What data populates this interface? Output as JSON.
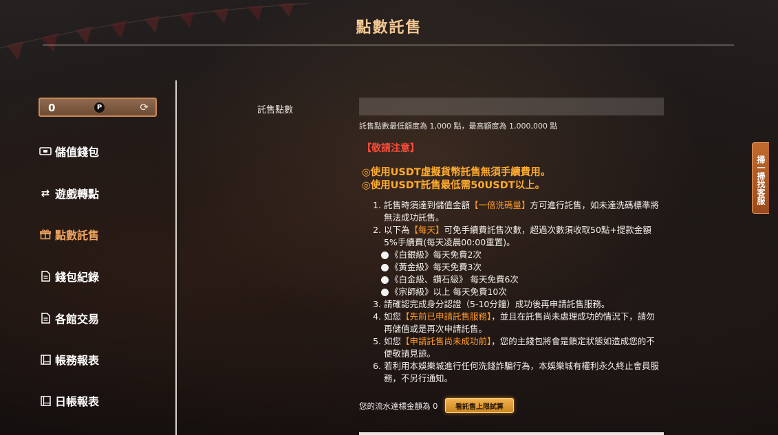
{
  "header": {
    "title": "點數託售"
  },
  "wallet": {
    "balance": "0",
    "currency_icon_label": "P",
    "currency_icon": "points-coin-icon",
    "refresh_icon": "refresh-icon"
  },
  "sidebar": {
    "items": [
      {
        "label": "儲值錢包",
        "icon": "wallet-icon"
      },
      {
        "label": "遊戲轉點",
        "icon": "transfer-arrows-icon"
      },
      {
        "label": "點數託售",
        "icon": "gift-icon",
        "active": true
      },
      {
        "label": "錢包紀錄",
        "icon": "document-icon"
      },
      {
        "label": "各館交易",
        "icon": "document-icon"
      },
      {
        "label": "帳務報表",
        "icon": "report-icon"
      },
      {
        "label": "日帳報表",
        "icon": "report-icon"
      }
    ]
  },
  "form": {
    "amount_label": "託售點數",
    "amount_value": "",
    "hint": "託售點數最低額度為 1,000 點，最高額度為 1,000,000 點"
  },
  "notice": {
    "title": "【敬請注意】",
    "highlights": [
      "◎使用USDT虛擬貨幣託售無須手續費用。",
      "◎使用USDT託售最低需50USDT以上。"
    ],
    "rules": [
      {
        "num": "1.",
        "pre": "託售時須達到儲值金額",
        "em": "【一倍洗碼量】",
        "post": "方可進行託售，如未達洗碼標準將無法成功託售。"
      },
      {
        "num": "2.",
        "pre": "以下為",
        "em": "【每天】",
        "post": "可免手續費託售次數，超過次數須收取50點+提款金額5%手續費(每天凌晨00:00重置)。"
      },
      {
        "num": "3.",
        "pre": "請確認完成身分認證（5-10分鐘）成功後再申請託售服務。",
        "em": "",
        "post": ""
      },
      {
        "num": "4.",
        "pre": "如您",
        "em": "【先前已申請託售服務】",
        "post": "，並且在託售尚未處理成功的情況下，請勿再儲值或是再次申請託售。"
      },
      {
        "num": "5.",
        "pre": "如您",
        "em": "【申請託售尚未成功前】",
        "post": "，您的主錢包將會是鎖定狀態如造成您的不便敬請見諒。"
      },
      {
        "num": "6.",
        "pre": "若利用本娛樂城進行任何洗錢詐騙行為，本娛樂城有權利永久終止會員服務，不另行通知。",
        "em": "",
        "post": ""
      }
    ],
    "tiers": [
      "《白銀級》每天免費2次",
      "《黃金級》每天免費3次",
      "《白金級、鑽石級》 每天免費6次",
      "《宗師級》以上 每天免費10次"
    ]
  },
  "footer": {
    "wager_text": "您的流水達標金額為 0",
    "calc_button": "看託售上限試算"
  },
  "support_tab": {
    "label": "掃一掃找客服"
  },
  "colors": {
    "accent": "#f0a55f",
    "title": "#f3c992",
    "warning": "#ff4a3a",
    "highlight": "#ffab2e"
  }
}
